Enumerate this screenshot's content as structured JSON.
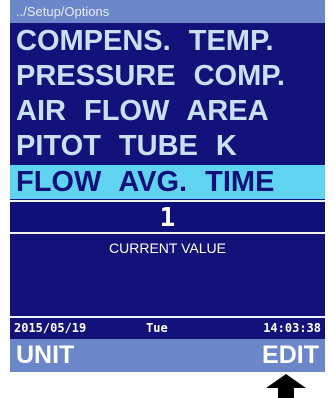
{
  "breadcrumb": "../Setup/Options",
  "menu": {
    "items": [
      {
        "label": "COMPENS.  TEMP."
      },
      {
        "label": "PRESSURE  COMP."
      },
      {
        "label": "AIR  FLOW  AREA"
      },
      {
        "label": "PITOT  TUBE  K"
      },
      {
        "label": "FLOW  AVG.  TIME"
      }
    ],
    "selected_index": 4
  },
  "current": {
    "value": "1",
    "caption": "CURRENT  VALUE"
  },
  "status": {
    "date": "2015/05/19",
    "day": "Tue",
    "time": "14:03:38"
  },
  "softkeys": {
    "left_label": "UNIT",
    "right_label": "EDIT"
  },
  "colors": {
    "background": "#12127a",
    "bar": "#6b86c9",
    "highlight": "#5fd3ef",
    "menu_text": "#c9e0f2"
  },
  "icons": {
    "pointer": "up-arrow-icon"
  }
}
